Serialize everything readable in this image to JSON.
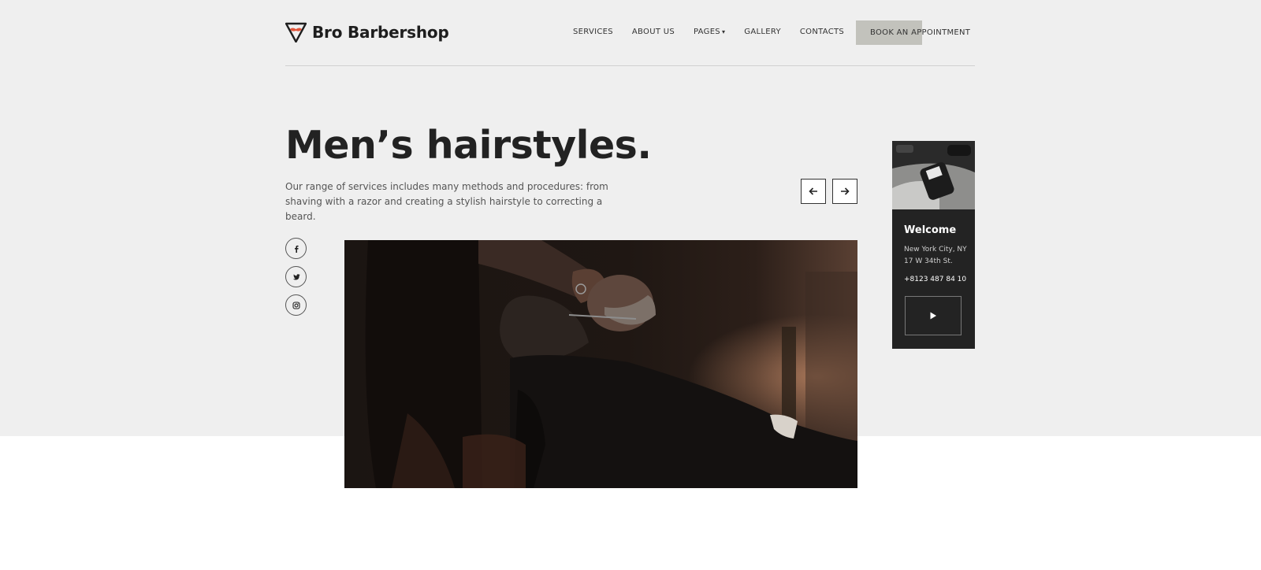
{
  "brand": {
    "name": "Bro Barbershop",
    "accent": "#e2553a"
  },
  "nav": {
    "items": [
      {
        "label": "SERVICES"
      },
      {
        "label": "ABOUT US"
      },
      {
        "label": "PAGES"
      },
      {
        "label": "GALLERY"
      },
      {
        "label": "CONTACTS"
      }
    ],
    "book_label": "BOOK AN APPOINTMENT"
  },
  "hero": {
    "title": "Men’s hairstyles.",
    "description": "Our range of services includes many methods and procedures: from shaving with a razor and creating a stylish hairstyle to correcting a beard."
  },
  "slider": {
    "prev_icon": "arrow-left-icon",
    "next_icon": "arrow-right-icon"
  },
  "social": [
    {
      "icon": "facebook-icon"
    },
    {
      "icon": "twitter-icon"
    },
    {
      "icon": "instagram-icon"
    }
  ],
  "side_card": {
    "welcome": "Welcome",
    "address": "New York City, NY 17 W 34th St.",
    "phone": "+8123 487 84 10",
    "play_icon": "play-icon"
  }
}
